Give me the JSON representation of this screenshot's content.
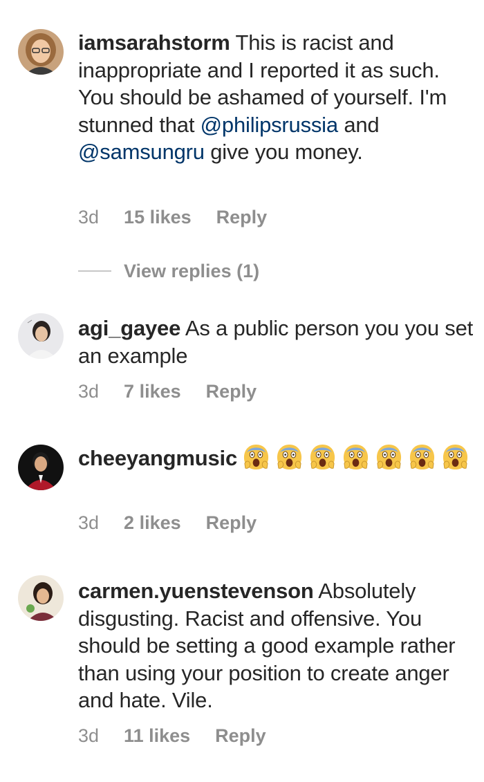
{
  "comments": [
    {
      "username": "iamsarahstorm",
      "text_1": " This is racist and inappropriate and I reported it as such. You should be ashamed of yourself. I'm stunned that ",
      "mention_1": "@philipsrussia",
      "text_2": " and ",
      "mention_2": "@samsungru",
      "text_3": " give you money.",
      "time": "3d",
      "likes": "15 likes",
      "reply": "Reply",
      "view_replies": "View replies (1)"
    },
    {
      "username": "agi_gayee",
      "text": " As a public person you you set an example",
      "time": "3d",
      "likes": "7 likes",
      "reply": "Reply"
    },
    {
      "username": "cheeyangmusic",
      "emoji": [
        "screaming-face-emoji",
        "screaming-face-emoji",
        "screaming-face-emoji",
        "screaming-face-emoji",
        "screaming-face-emoji",
        "screaming-face-emoji",
        "screaming-face-emoji"
      ],
      "time": "3d",
      "likes": "2 likes",
      "reply": "Reply"
    },
    {
      "username": "carmen.yuenstevenson",
      "text": " Absolutely disgusting. Racist and offensive. You should be setting a good example rather than using your position to create anger and hate. Vile.",
      "time": "3d",
      "likes": "11 likes",
      "reply": "Reply"
    }
  ],
  "colors": {
    "text": "#262626",
    "meta": "#8e8e8e",
    "mention": "#003569",
    "background": "#ffffff"
  }
}
